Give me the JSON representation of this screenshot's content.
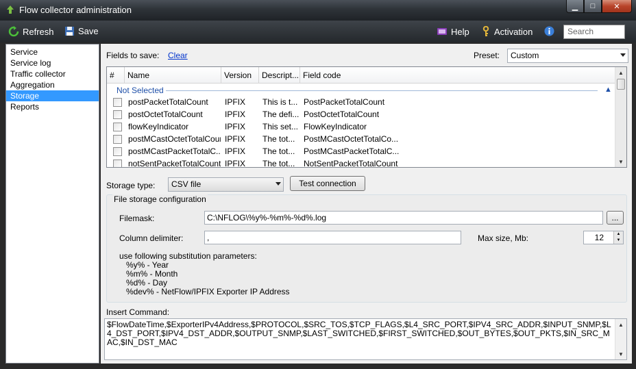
{
  "window": {
    "title": "Flow collector administration"
  },
  "toolbar": {
    "refresh_label": "Refresh",
    "save_label": "Save",
    "help_label": "Help",
    "activation_label": "Activation",
    "search_placeholder": "Search"
  },
  "sidebar": {
    "items": [
      {
        "label": "Service"
      },
      {
        "label": "Service log"
      },
      {
        "label": "Traffic collector"
      },
      {
        "label": "Aggregation"
      },
      {
        "label": "Storage",
        "selected": true
      },
      {
        "label": "Reports"
      }
    ]
  },
  "fields": {
    "label": "Fields to save:",
    "clear_label": "Clear",
    "preset_label": "Preset:",
    "preset_value": "Custom",
    "columns": [
      "#",
      "Name",
      "Version",
      "Descript...",
      "Field code"
    ],
    "group_title": "Not Selected",
    "rows": [
      {
        "name": "postPacketTotalCount",
        "version": "IPFIX",
        "description": "This is t...",
        "code": "PostPacketTotalCount"
      },
      {
        "name": "postOctetTotalCount",
        "version": "IPFIX",
        "description": "The defi...",
        "code": "PostOctetTotalCount"
      },
      {
        "name": "flowKeyIndicator",
        "version": "IPFIX",
        "description": "This set...",
        "code": "FlowKeyIndicator"
      },
      {
        "name": "postMCastOctetTotalCount",
        "version": "IPFIX",
        "description": "The tot...",
        "code": "PostMCastOctetTotalCo..."
      },
      {
        "name": "postMCastPacketTotalC...",
        "version": "IPFIX",
        "description": "The tot...",
        "code": "PostMCastPacketTotalC..."
      },
      {
        "name": "notSentPacketTotalCount",
        "version": "IPFIX",
        "description": "The tot...",
        "code": "NotSentPacketTotalCount"
      }
    ]
  },
  "storage": {
    "type_label": "Storage type:",
    "type_value": "CSV file",
    "test_button": "Test connection"
  },
  "file_config": {
    "title": "File storage configuration",
    "filemask_label": "Filemask:",
    "filemask_value": "C:\\NFLOG\\%y%-%m%-%d%.log",
    "browse_label": "...",
    "delimiter_label": "Column delimiter:",
    "delimiter_value": ",",
    "maxsize_label": "Max size, Mb:",
    "maxsize_value": "12",
    "help_intro": "use following substitution parameters:",
    "help_params": [
      "%y% - Year",
      "%m% - Month",
      "%d% - Day",
      "%dev% - NetFlow/IPFIX Exporter IP Address"
    ]
  },
  "insert": {
    "label": "Insert Command:",
    "value": "$FlowDateTime,$ExporterIPv4Address,$PROTOCOL,$SRC_TOS,$TCP_FLAGS,$L4_SRC_PORT,$IPV4_SRC_ADDR,$INPUT_SNMP,$L4_DST_PORT,$IPV4_DST_ADDR,$OUTPUT_SNMP,$LAST_SWITCHED,$FIRST_SWITCHED,$OUT_BYTES,$OUT_PKTS,$IN_SRC_MAC,$IN_DST_MAC"
  },
  "colors": {
    "selection": "#3399ff",
    "link": "#0033cc",
    "group_title": "#1e4fa8"
  }
}
